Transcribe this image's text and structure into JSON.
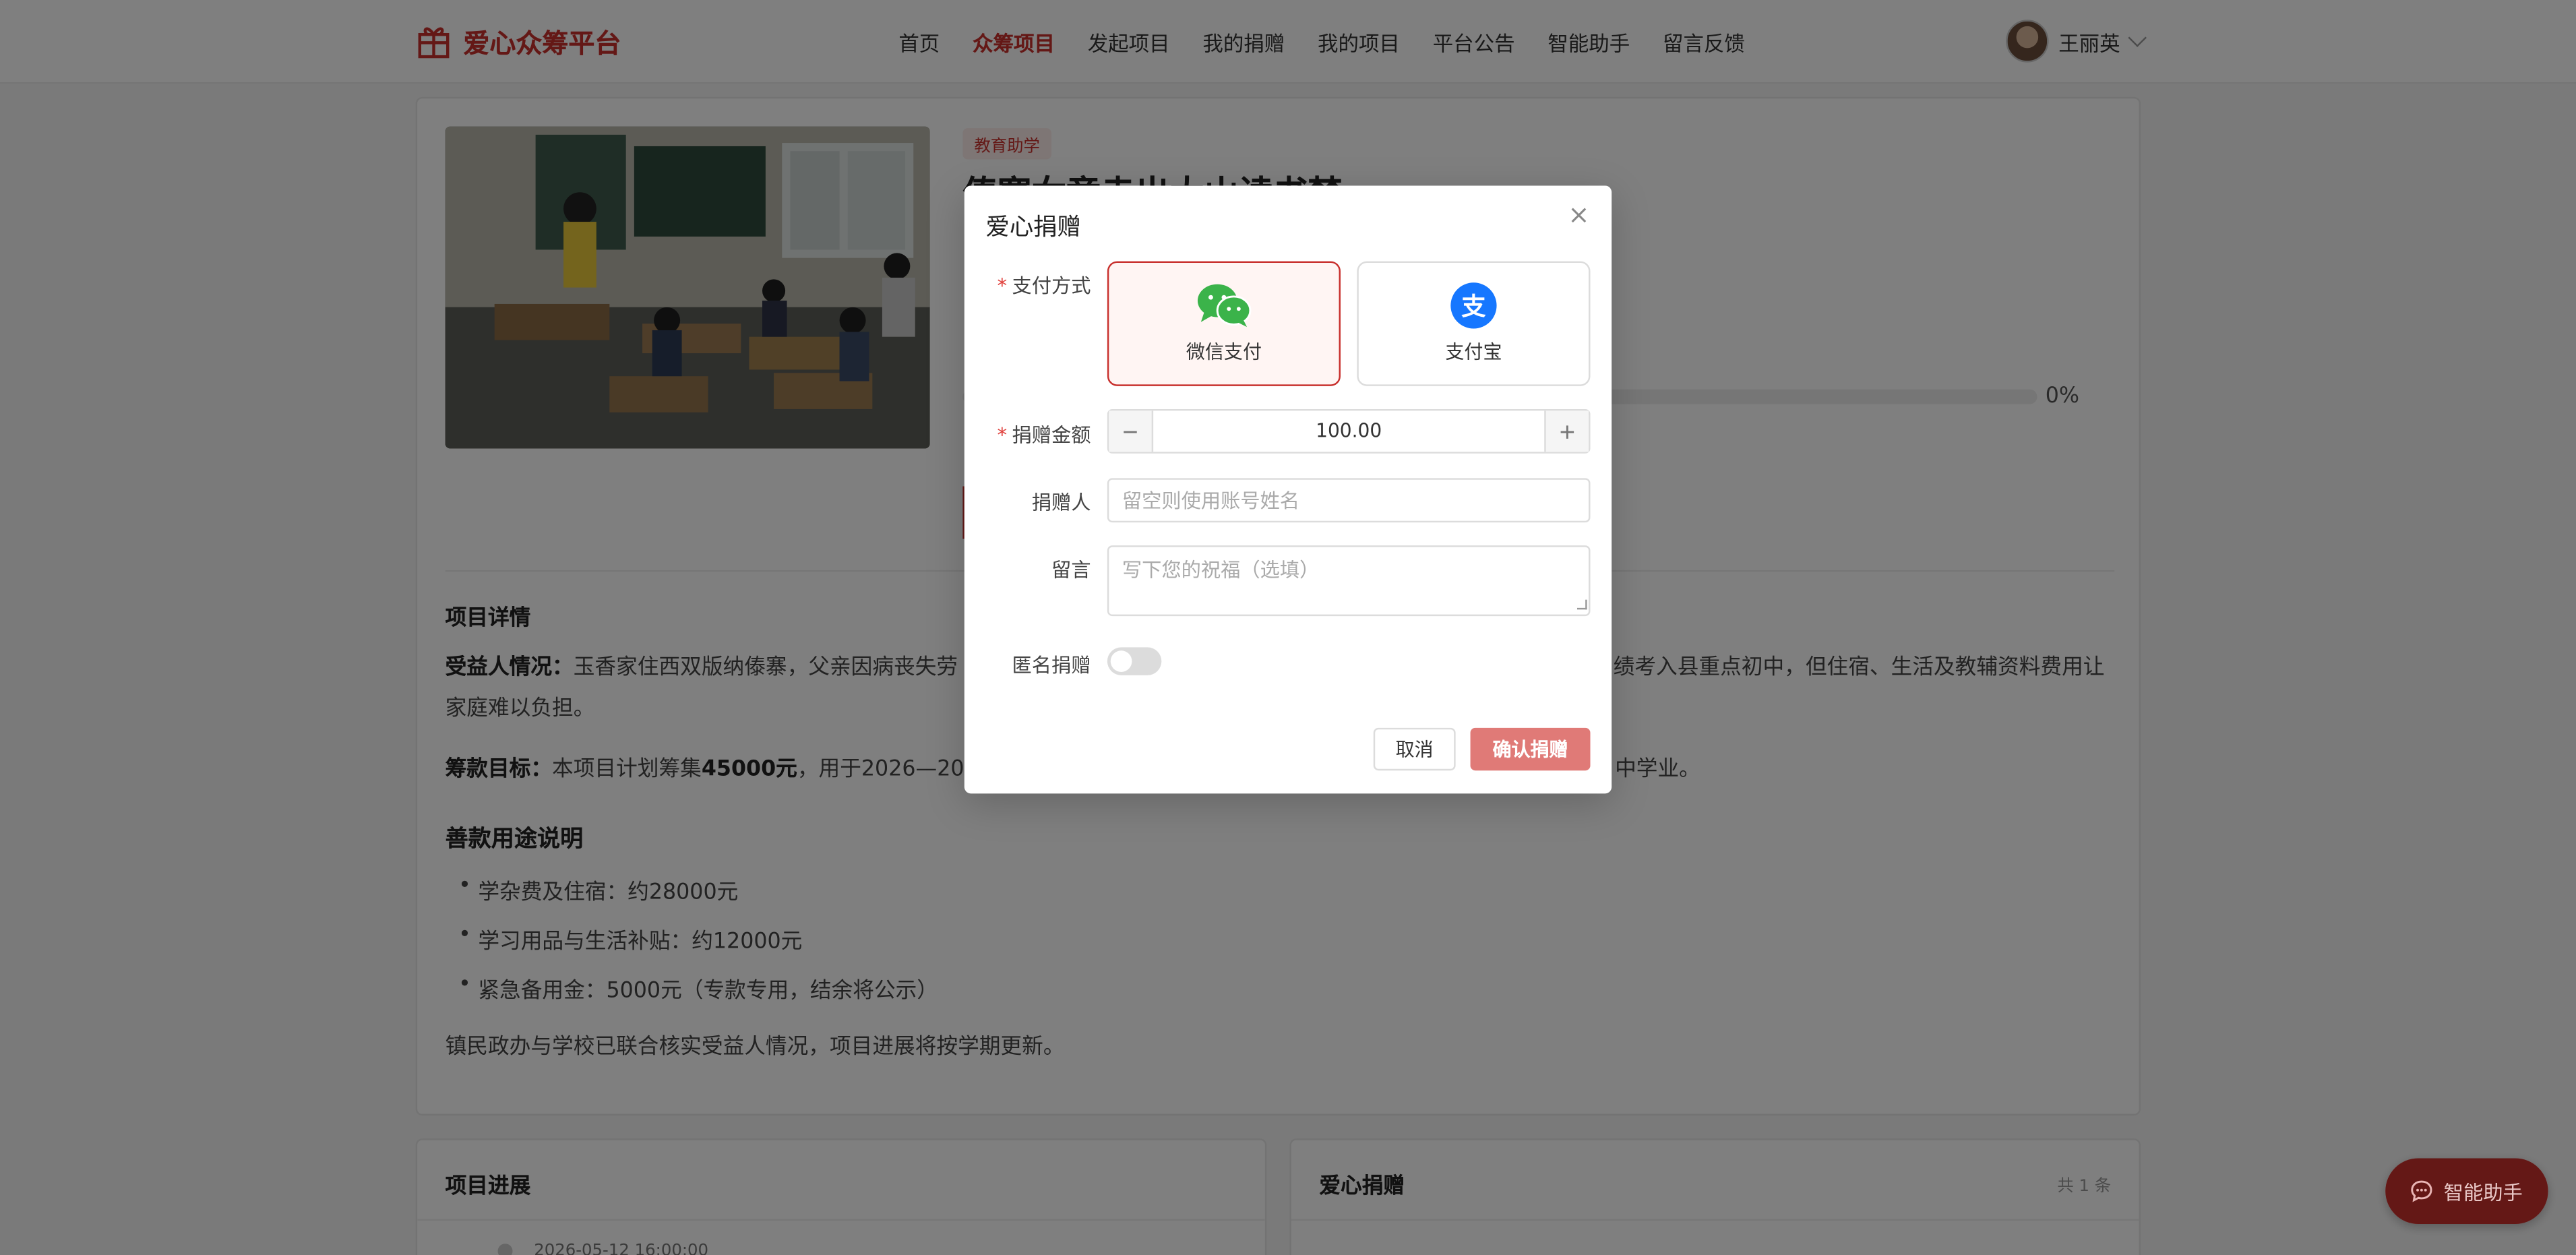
{
  "header": {
    "logo_text": "爱心众筹平台",
    "nav": [
      "首页",
      "众筹项目",
      "发起项目",
      "我的捐赠",
      "我的项目",
      "平台公告",
      "智能助手",
      "留言反馈"
    ],
    "active_nav": "众筹项目",
    "user_name": "王丽英"
  },
  "project": {
    "tag": "教育助学",
    "title": "傣寨女童走出大山读书梦",
    "progress_percent_label": "0%",
    "progress_value": 0,
    "details_title": "项目详情",
    "beneficiary_label": "受益人情况：",
    "beneficiary_text_start": "玉香家住西双版纳傣寨，父亲因病丧失劳",
    "beneficiary_text_end": "绩考入县重点初中，但住宿、生活及教辅资料费用让",
    "beneficiary_text_line2": "家庭难以负担。",
    "goal_label": "筹款目标：",
    "goal_text_a": "本项目计划筹集",
    "goal_amount": "45000元",
    "goal_text_b": "，用于2026—2027",
    "goal_text_end": "中学业。",
    "usage_title": "善款用途说明",
    "usage_items": [
      "学杂费及住宿：约28000元",
      "学习用品与生活补贴：约12000元",
      "紧急备用金：5000元（专款专用，结余将公示）"
    ],
    "note": "镇民政办与学校已联合核实受益人情况，项目进展将按学期更新。"
  },
  "progress_card": {
    "title": "项目进展",
    "first_time": "2026-05-12 16:00:00"
  },
  "donations_card": {
    "title": "爱心捐赠",
    "count": "共 1 条"
  },
  "assistant": {
    "label": "智能助手"
  },
  "modal": {
    "title": "爱心捐赠",
    "payment_label": "支付方式",
    "payment_options": [
      "微信支付",
      "支付宝"
    ],
    "selected_payment": "微信支付",
    "amount_label": "捐赠金额",
    "amount_value": "100.00",
    "donor_label": "捐赠人",
    "donor_placeholder": "留空则使用账号姓名",
    "message_label": "留言",
    "message_placeholder": "写下您的祝福（选填）",
    "anonymous_label": "匿名捐赠",
    "anonymous_on": false,
    "cancel_label": "取消",
    "confirm_label": "确认捐赠"
  },
  "colors": {
    "brand": "#c8302d",
    "wechat": "#3bb34a",
    "alipay": "#1677ff"
  }
}
